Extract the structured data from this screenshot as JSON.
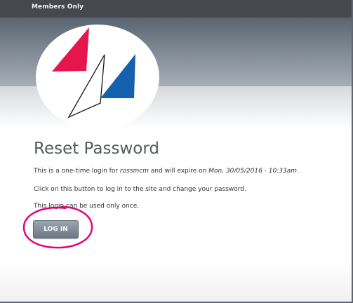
{
  "topbar": {
    "link_label": "Members Only"
  },
  "logo": {
    "name": "sailing-sails-logo",
    "colors": {
      "left": "#e5154e",
      "right": "#1660b0",
      "outline": "#222222"
    }
  },
  "page": {
    "title": "Reset Password"
  },
  "message": {
    "line1_prefix": "This is a one-time login for ",
    "username": "rossmcm",
    "line1_middle": " and will expire on ",
    "expiry": "Mon, 30/05/2016 - 10:33am",
    "line1_suffix": ".",
    "line2": "Click on this button to log in to the site and change your password.",
    "line3": "This login can be used only once."
  },
  "actions": {
    "login_label": "LOG IN"
  },
  "annotation": {
    "color": "#e0007a"
  }
}
